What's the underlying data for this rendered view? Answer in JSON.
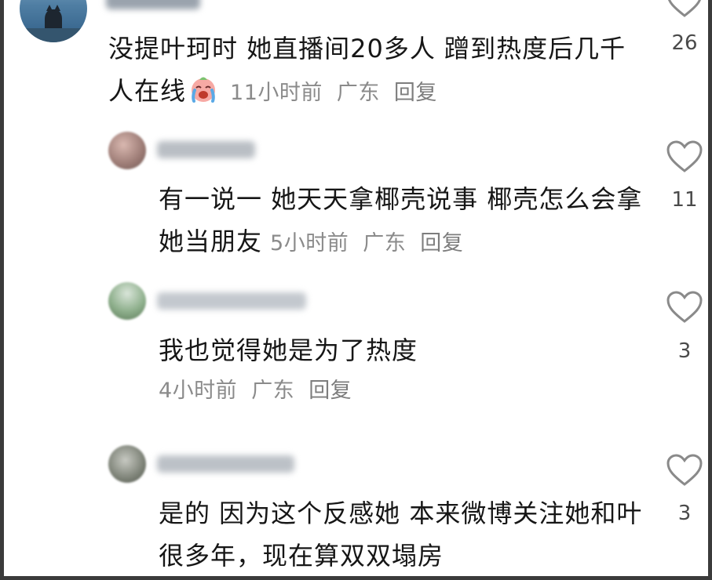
{
  "comments": [
    {
      "text": "没提叶珂时 她直播间20多人 蹭到热度后几千人在线",
      "emoji": "crying-laughing-emoji",
      "time": "11小时前",
      "location": "广东",
      "reply_label": "回复",
      "likes": "26"
    }
  ],
  "replies": [
    {
      "text": "有一说一 她天天拿椰壳说事 椰壳怎么会拿她当朋友",
      "time": "5小时前",
      "location": "广东",
      "reply_label": "回复",
      "likes": "11"
    },
    {
      "text": "我也觉得她是为了热度",
      "time": "4小时前",
      "location": "广东",
      "reply_label": "回复",
      "likes": "3"
    },
    {
      "text": "是的 因为这个反感她 本来微博关注她和叶很多年，现在算双双塌房",
      "likes": "3"
    }
  ],
  "icons": {
    "like": "heart-outline-icon"
  },
  "colors": {
    "text": "#161616",
    "meta": "#8b8b8b",
    "frame": "#3b3b3b",
    "heart": "#8a8a8a"
  }
}
